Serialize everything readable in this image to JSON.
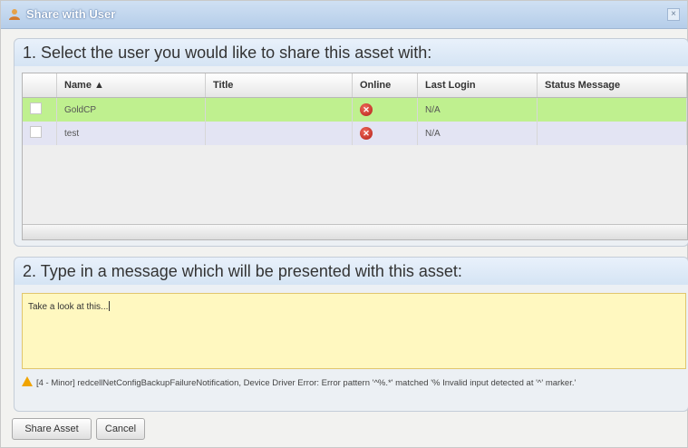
{
  "window": {
    "title": "Share with User",
    "close_label": "×"
  },
  "section1": {
    "heading": "1. Select the user you would like to share this asset with:"
  },
  "table": {
    "columns": [
      "",
      "Name ▲",
      "Title",
      "Online",
      "Last Login",
      "Status Message"
    ],
    "rows": [
      {
        "name": "GoldCP",
        "title": "",
        "online": "offline",
        "last_login": "N/A",
        "status": ""
      },
      {
        "name": "test",
        "title": "",
        "online": "offline",
        "last_login": "N/A",
        "status": ""
      }
    ]
  },
  "section2": {
    "heading": "2. Type in a message which will be presented with this asset:",
    "message_value": "Take a look at this..."
  },
  "warning": {
    "text": "[4 - Minor] redcellNetConfigBackupFailureNotification, Device Driver Error: Error pattern '^%.*' matched '% Invalid input detected at '^' marker.'"
  },
  "buttons": {
    "share": "Share Asset",
    "cancel": "Cancel"
  },
  "colors": {
    "row_selected": "#bff08f",
    "row_alt": "#e3e4f3",
    "message_bg": "#fff8c0",
    "offline_icon": "#c62a1f"
  },
  "icons": {
    "title": "user-share-icon",
    "online": "offline-x-icon",
    "warning": "warning-triangle-icon"
  }
}
